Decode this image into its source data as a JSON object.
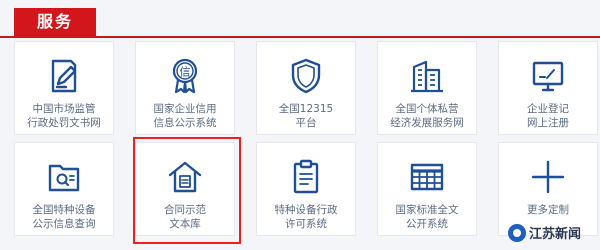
{
  "header": {
    "title": "服务"
  },
  "services": [
    {
      "name": "case-docs",
      "label_line1": "中国市场监管",
      "label_line2": "行政处罚文书网",
      "icon": "document-edit-icon"
    },
    {
      "name": "credit-info",
      "label_line1": "国家企业信用",
      "label_line2": "信息公示系统",
      "icon": "credit-badge-icon"
    },
    {
      "name": "hotline-12315",
      "label_line1": "全国12315",
      "label_line2": "平台",
      "icon": "shield-icon"
    },
    {
      "name": "private-dev",
      "label_line1": "全国个体私营",
      "label_line2": "经济发展服务网",
      "icon": "buildings-icon"
    },
    {
      "name": "enterprise-register",
      "label_line1": "企业登记",
      "label_line2": "网上注册",
      "icon": "monitor-edit-icon"
    },
    {
      "name": "special-equipment",
      "label_line1": "全国特种设备",
      "label_line2": "公示信息查询",
      "icon": "folder-search-icon"
    },
    {
      "name": "contract-library",
      "label_line1": "合同示范",
      "label_line2": "文本库",
      "icon": "house-document-icon"
    },
    {
      "name": "equipment-license",
      "label_line1": "特种设备行政",
      "label_line2": "许可系统",
      "icon": "clipboard-icon"
    },
    {
      "name": "standards",
      "label_line1": "国家标准全文",
      "label_line2": "公开系统",
      "icon": "grid-table-icon"
    },
    {
      "name": "more-custom",
      "label_line1": "更多定制",
      "label_line2": "",
      "icon": "plus-icon"
    }
  ],
  "watermark": {
    "text": "江苏新闻"
  },
  "colors": {
    "brand_red": "#d3161b",
    "icon_blue": "#1f4f96",
    "highlight_red": "#e8231f"
  }
}
